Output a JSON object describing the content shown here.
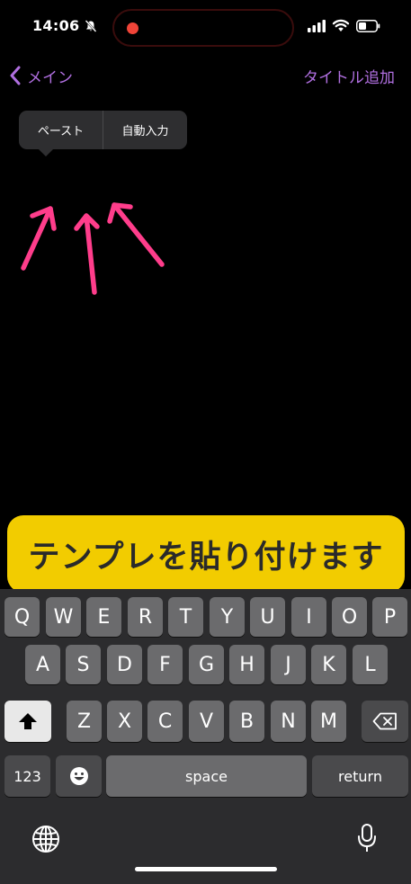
{
  "status_bar": {
    "time": "14:06"
  },
  "nav": {
    "back_label": "メイン",
    "right_action": "タイトル追加"
  },
  "popover": {
    "items": [
      "ペースト",
      "自動入力"
    ]
  },
  "banner": {
    "text": "テンプレを貼り付けます"
  },
  "keyboard": {
    "row1": [
      "Q",
      "W",
      "E",
      "R",
      "T",
      "Y",
      "U",
      "I",
      "O",
      "P"
    ],
    "row2": [
      "A",
      "S",
      "D",
      "F",
      "G",
      "H",
      "J",
      "K",
      "L"
    ],
    "row3": [
      "Z",
      "X",
      "C",
      "V",
      "B",
      "N",
      "M"
    ],
    "numbers_label": "123",
    "space_label": "space",
    "return_label": "return"
  },
  "colors": {
    "accent": "#b06fe0",
    "banner": "#f2cc00",
    "arrows": "#ff3d8b",
    "record_dot": "#f04438"
  }
}
